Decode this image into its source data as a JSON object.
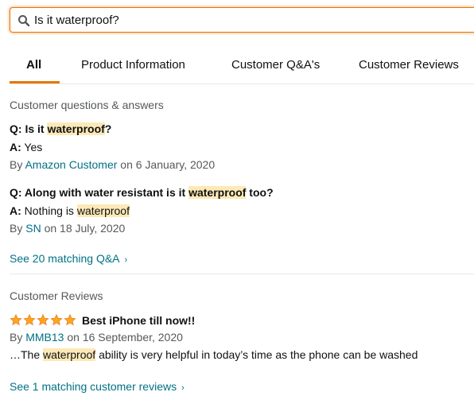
{
  "search": {
    "value": "Is it waterproof?",
    "icon": "search-icon"
  },
  "tabs": [
    {
      "label": "All",
      "active": true
    },
    {
      "label": "Product Information",
      "active": false
    },
    {
      "label": "Customer Q&A's",
      "active": false
    },
    {
      "label": "Customer Reviews",
      "active": false
    }
  ],
  "qa": {
    "title": "Customer questions & answers",
    "items": [
      {
        "q_prefix": "Q: Is it ",
        "q_highlight": "waterproof",
        "q_suffix": "?",
        "a_label": "A:",
        "a_text": "Yes",
        "a_highlight": "",
        "by": "By",
        "author": "Amazon Customer",
        "date": "on 6 January, 2020"
      },
      {
        "q_prefix": "Q: Along with water resistant is it ",
        "q_highlight": "waterproof",
        "q_suffix": " too?",
        "a_label": "A:",
        "a_text": "Nothing is",
        "a_highlight": "waterproof",
        "by": "By",
        "author": "SN",
        "date": "on 18 July, 2020"
      }
    ],
    "see_more": "See 20 matching Q&A"
  },
  "reviews": {
    "title": "Customer Reviews",
    "items": [
      {
        "rating": 5,
        "headline": "Best iPhone till now!!",
        "by": "By",
        "author": "MMB13",
        "date": "on 16 September, 2020",
        "excerpt_prefix": "…The",
        "excerpt_highlight": "waterproof",
        "excerpt_suffix": "ability is very helpful in today’s time as the phone can be washed"
      }
    ],
    "see_more": "See 1 matching customer reviews"
  },
  "colors": {
    "accent": "#e77600",
    "link": "#007185",
    "highlight": "#fde9b7",
    "star": "#ffa41c"
  }
}
